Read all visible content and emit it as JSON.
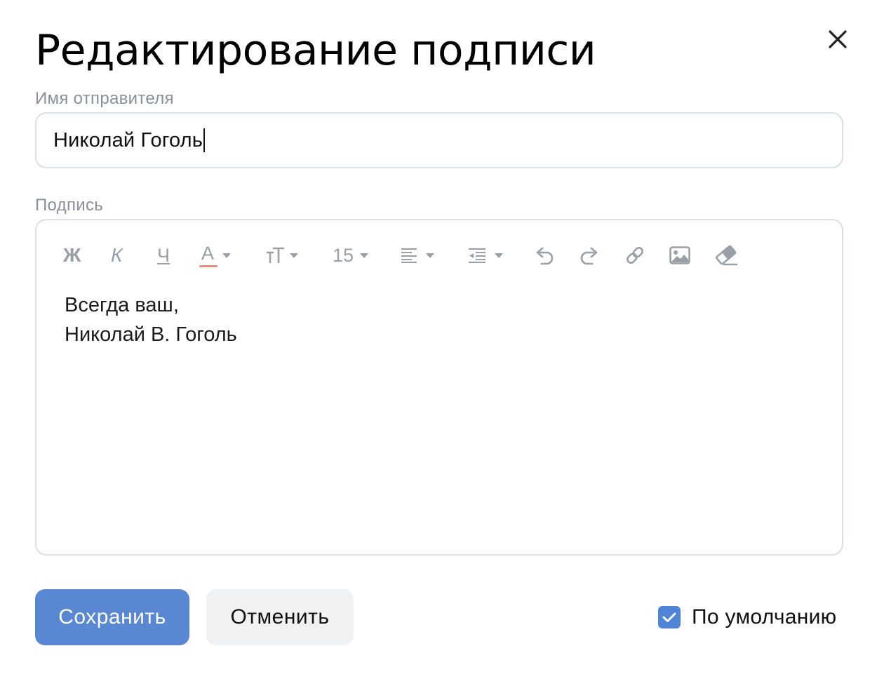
{
  "dialog": {
    "title": "Редактирование подписи",
    "close_icon": "close-icon"
  },
  "sender": {
    "label": "Имя отправителя",
    "value": "Николай Гоголь"
  },
  "signature": {
    "label": "Подпись",
    "toolbar": {
      "bold": "Ж",
      "italic": "К",
      "underline": "Ч",
      "text_color": "A",
      "font_size": "15",
      "icons": [
        "bold-icon",
        "italic-icon",
        "underline-icon",
        "text-color-icon",
        "font-style-icon",
        "font-size-select",
        "align-icon",
        "indent-icon",
        "undo-icon",
        "redo-icon",
        "link-icon",
        "image-icon",
        "eraser-icon"
      ]
    },
    "lines": [
      "Всегда ваш,",
      "Николай В. Гоголь"
    ]
  },
  "actions": {
    "save_label": "Сохранить",
    "cancel_label": "Отменить"
  },
  "default_option": {
    "label": "По умолчанию",
    "checked": true
  },
  "colors": {
    "primary": "#5a87d2",
    "checkbox": "#4f84d6",
    "text_color_underline": "#e8907a",
    "border": "#dcdfe4",
    "muted": "#8a8f99"
  }
}
